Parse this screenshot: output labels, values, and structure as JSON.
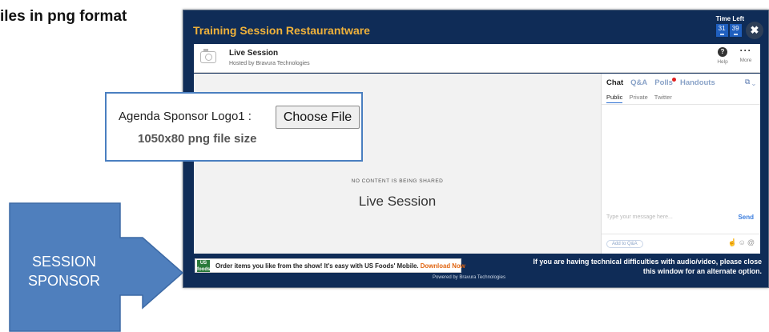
{
  "heading": "iles in png format",
  "window": {
    "title": "Training Session Restaurantware",
    "timer_label": "Time Left",
    "timer_values": [
      "31",
      "39"
    ],
    "close_glyph": "✖"
  },
  "session": {
    "title": "Live Session",
    "hosted_by": "Hosted by Bravura Technologies",
    "help_label": "Help",
    "more_label": "More",
    "no_content": "NO CONTENT IS BEING SHARED",
    "stage_title": "Live Session"
  },
  "chat": {
    "tabs": [
      "Chat",
      "Q&A",
      "Polls",
      "Handouts"
    ],
    "sub_tabs": [
      "Public",
      "Private",
      "Twitter"
    ],
    "input_placeholder": "Type your message here...",
    "send_label": "Send",
    "add_qa_label": "Add to Q&A"
  },
  "footer": {
    "ad_text": "Order items you like from the show! It's easy with US Foods' Mobile.",
    "ad_link": "Download Now",
    "usf_logo": "US foods",
    "tech_note": "If you are having technical difficulties with audio/video, please close this window for an alternate option.",
    "powered_by": "Powered by Bravura Technologies"
  },
  "callout": {
    "label": "Agenda Sponsor Logo1 :",
    "button": "Choose File",
    "size_note": "1050x80 png file size"
  },
  "sponsor_arrow": {
    "line1": "SESSION",
    "line2": "SPONSOR"
  },
  "colors": {
    "window_bg": "#0f2c57",
    "title_accent": "#f0b23a",
    "callout_border": "#4a7fc0",
    "arrow_fill": "#4f7fbd"
  }
}
